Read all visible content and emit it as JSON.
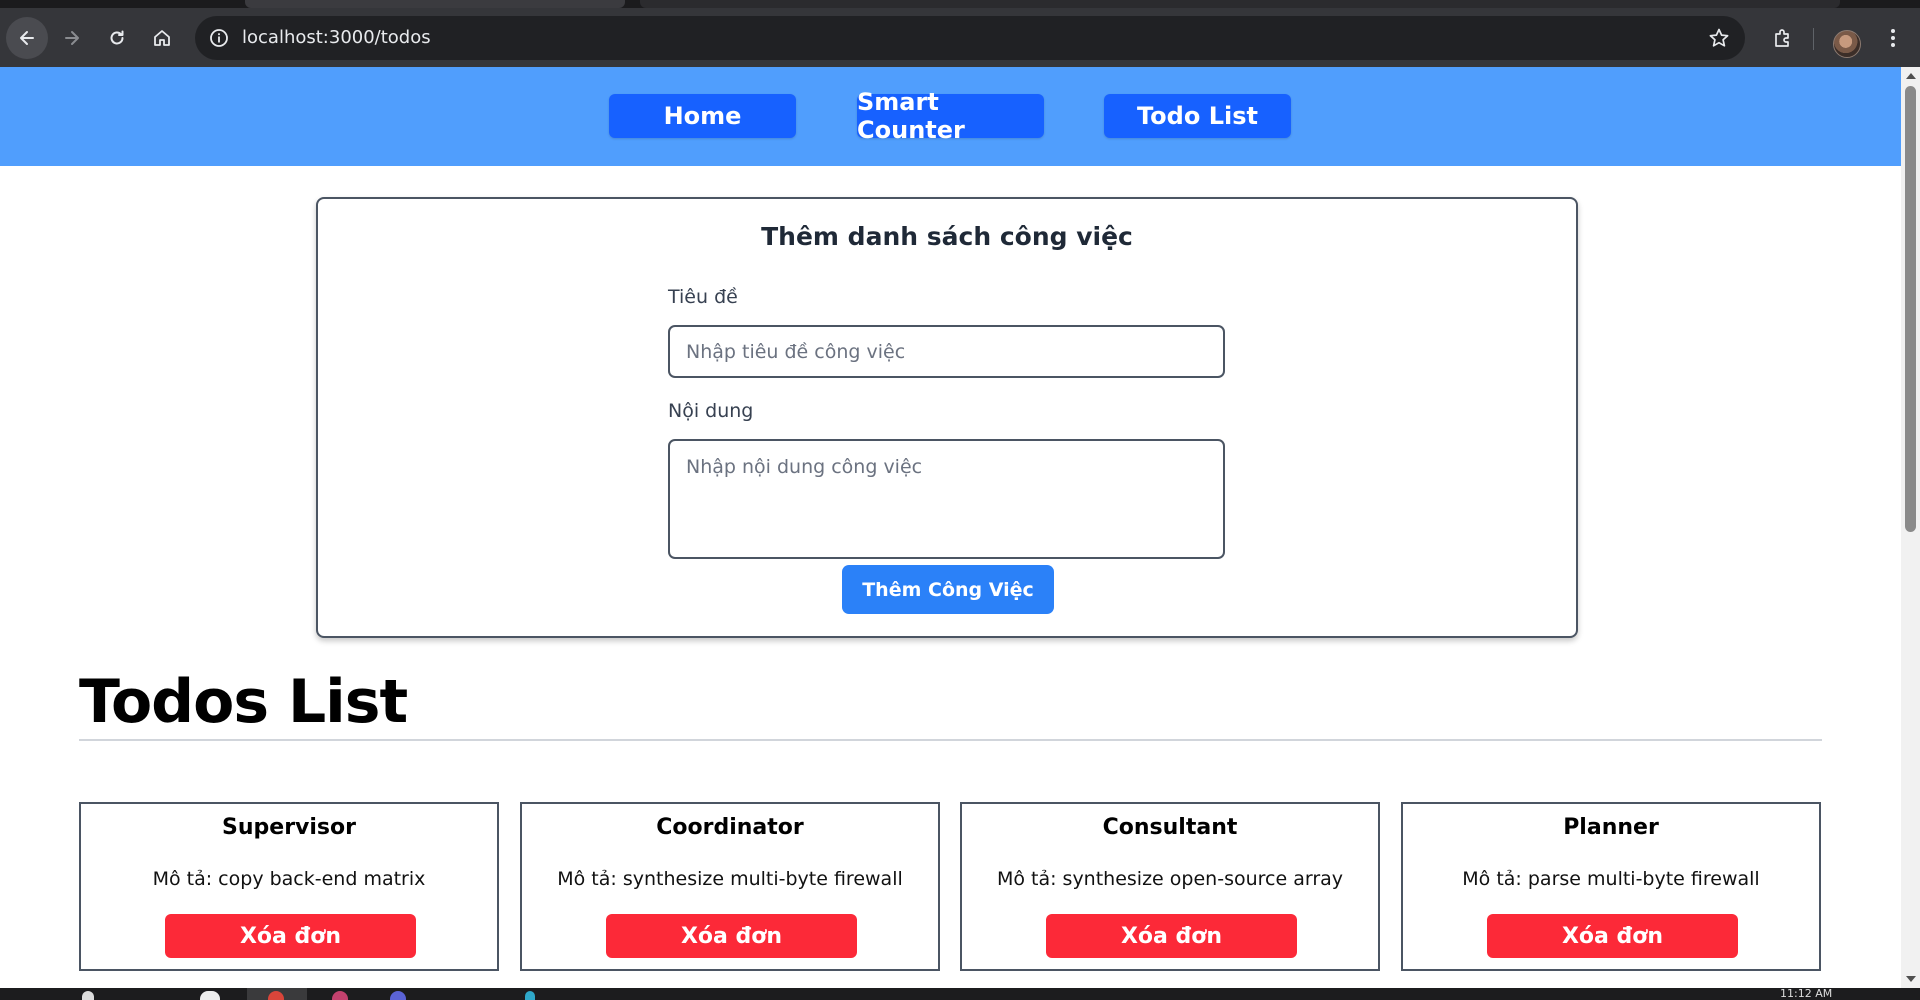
{
  "browser": {
    "url": "localhost:3000/todos",
    "icons": [
      "back-arrow-icon",
      "forward-arrow-icon",
      "reload-icon",
      "home-icon",
      "info-icon",
      "star-icon",
      "extensions-icon",
      "profile-avatar",
      "more-vert-icon"
    ]
  },
  "nav": {
    "items": [
      {
        "label": "Home"
      },
      {
        "label": "Smart Counter"
      },
      {
        "label": "Todo List"
      }
    ],
    "bar_color": "#509efd",
    "button_color": "#1761ff"
  },
  "form": {
    "title": "Thêm danh sách công việc",
    "title_label": "Tiêu đề",
    "title_placeholder": "Nhập tiêu đề công việc",
    "content_label": "Nội dung",
    "content_placeholder": "Nhập nội dung công việc",
    "submit_label": "Thêm Công Việc",
    "submit_color": "#2b81f8"
  },
  "todos": {
    "heading": "Todos List",
    "desc_prefix": "Mô tả: ",
    "delete_label": "Xóa đơn",
    "delete_color": "#fc2938",
    "items": [
      {
        "title": "Supervisor",
        "desc": "Mô tả: copy back-end matrix"
      },
      {
        "title": "Coordinator",
        "desc": "Mô tả: synthesize multi-byte firewall"
      },
      {
        "title": "Consultant",
        "desc": "Mô tả: synthesize open-source array"
      },
      {
        "title": "Planner",
        "desc": "Mô tả: parse multi-byte firewall"
      }
    ]
  },
  "taskbar": {
    "clock": "11:12 AM"
  }
}
